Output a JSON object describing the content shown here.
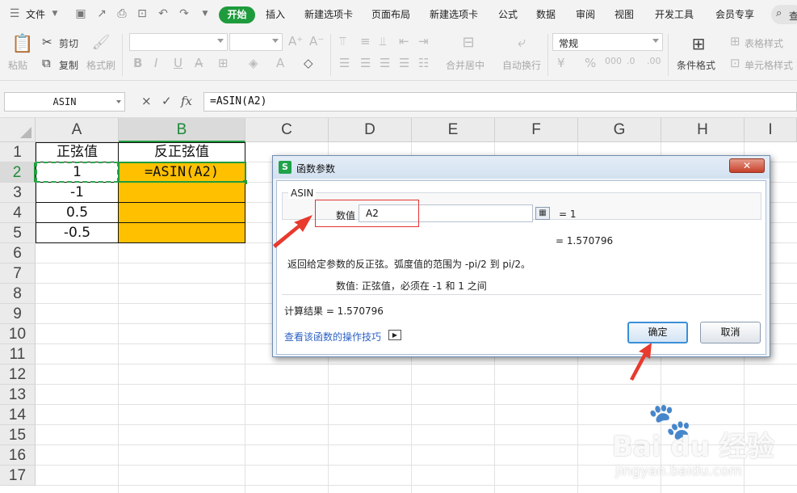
{
  "menu": {
    "file": "文件",
    "tabs": [
      "开始",
      "插入",
      "新建选项卡",
      "页面布局",
      "新建选项卡",
      "公式",
      "数据",
      "审阅",
      "视图",
      "开发工具",
      "会员专享"
    ],
    "search": "查"
  },
  "ribbon": {
    "paste": "粘贴",
    "cut": "剪切",
    "copy": "复制",
    "format_painter": "格式刷",
    "number_format": "常规",
    "merge_center": "合并居中",
    "wrap_text": "自动换行",
    "cond_format": "条件格式",
    "table_style": "表格样式",
    "cell_style": "单元格样式"
  },
  "formula_bar": {
    "name_box": "ASIN",
    "cancel": "×",
    "confirm": "✓",
    "fx": "fx",
    "formula": "=ASIN(A2)"
  },
  "grid": {
    "columns": [
      "A",
      "B",
      "C",
      "D",
      "E",
      "F",
      "G",
      "H",
      "I"
    ],
    "rows": [
      "1",
      "2",
      "3",
      "4",
      "5",
      "6",
      "7",
      "8",
      "9",
      "10",
      "11",
      "12",
      "13",
      "14",
      "15",
      "16",
      "17"
    ],
    "cells": {
      "a1": "正弦值",
      "b1": "反正弦值",
      "a2": "1",
      "b2": "=ASIN(A2)",
      "a3": "-1",
      "a4": "0.5",
      "a5": "-0.5"
    },
    "highlight_color": "#ffc000",
    "accent_color": "#1e9b3c"
  },
  "dialog": {
    "title": "函数参数",
    "function_name": "ASIN",
    "arg_label": "数值",
    "arg_value": "A2",
    "arg_result": "= 1",
    "result": "= 1.570796",
    "description": "返回给定参数的反正弦。弧度值的范围为 -pi/2 到 pi/2。",
    "param_help": "数值:  正弦值，必须在 -1 和 1 之间",
    "calc_result": "计算结果 = 1.570796",
    "help_link": "查看该函数的操作技巧",
    "ok": "确定",
    "cancel": "取消"
  },
  "watermark": {
    "brand": "Bai du 经验",
    "url": "jingyan.baidu.com"
  }
}
